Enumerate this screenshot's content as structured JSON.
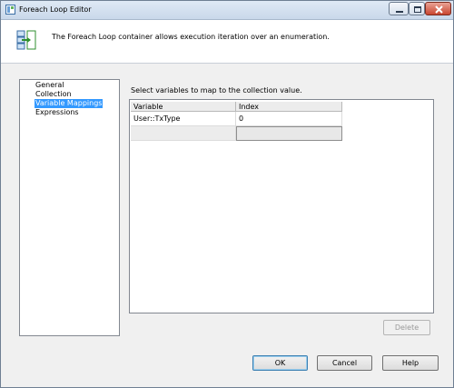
{
  "window": {
    "title": "Foreach Loop Editor"
  },
  "header": {
    "description": "The Foreach Loop container allows execution iteration over an enumeration.",
    "icon": "foreach-loop-icon"
  },
  "nav": {
    "items": [
      {
        "label": "General",
        "selected": false
      },
      {
        "label": "Collection",
        "selected": false
      },
      {
        "label": "Variable Mappings",
        "selected": true
      },
      {
        "label": "Expressions",
        "selected": false
      }
    ]
  },
  "panel": {
    "instruction": "Select variables to map to the collection value.",
    "columns": [
      "Variable",
      "Index"
    ],
    "rows": [
      {
        "variable": "User::TxType",
        "index": "0"
      }
    ]
  },
  "buttons": {
    "delete": "Delete",
    "ok": "OK",
    "cancel": "Cancel",
    "help": "Help"
  },
  "colors": {
    "selection": "#3399ff",
    "title_gradient_top": "#dfe9f5",
    "close_button": "#c9452f"
  }
}
